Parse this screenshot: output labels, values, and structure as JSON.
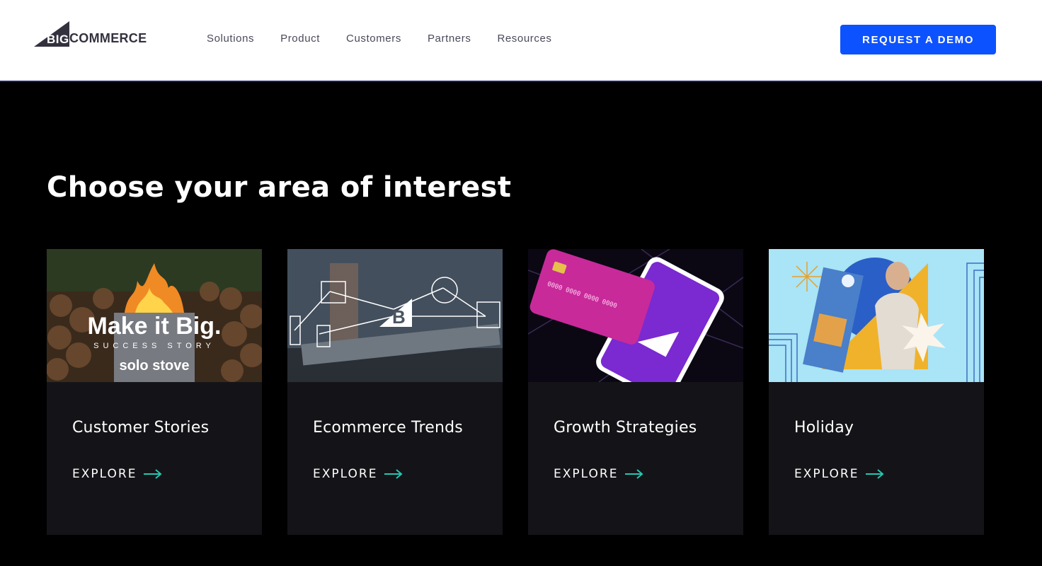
{
  "brand": {
    "logo_big": "BIG",
    "logo_commerce": "COMMERCE"
  },
  "nav": {
    "items": [
      {
        "label": "Solutions"
      },
      {
        "label": "Product"
      },
      {
        "label": "Customers"
      },
      {
        "label": "Partners"
      },
      {
        "label": "Resources"
      }
    ]
  },
  "header": {
    "cta_label": "REQUEST A DEMO",
    "cta_color": "#0d52ff"
  },
  "main": {
    "heading": "Choose your area of interest",
    "cards": [
      {
        "title": "Customer Stories",
        "link_label": "EXPLORE",
        "image_text": {
          "headline": "Make it Big.",
          "sub": "SUCCESS STORY",
          "brand": "solo stove"
        },
        "image_icon": "fire-pit-icon"
      },
      {
        "title": "Ecommerce Trends",
        "link_label": "EXPLORE",
        "image_icon": "tablet-network-icon"
      },
      {
        "title": "Growth Strategies",
        "link_label": "EXPLORE",
        "image_icon": "credit-card-phone-icon"
      },
      {
        "title": "Holiday",
        "link_label": "EXPLORE",
        "image_icon": "woman-gift-icon"
      }
    ]
  },
  "colors": {
    "accent_arrow": "#26c6b0",
    "card_bg": "#141418",
    "page_bg": "#000000"
  }
}
